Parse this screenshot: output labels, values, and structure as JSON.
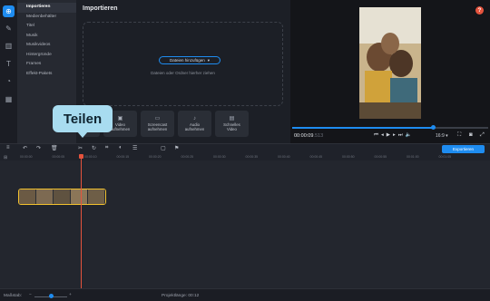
{
  "sidebar_menu": [
    {
      "label": "Importieren",
      "selected": true
    },
    {
      "label": "Medienbehälter",
      "selected": false
    },
    {
      "label": "Titel",
      "selected": false
    },
    {
      "label": "Musik",
      "selected": false
    },
    {
      "label": "Musikvideos",
      "selected": false
    },
    {
      "label": "Hintergründe",
      "selected": false
    },
    {
      "label": "Frames",
      "selected": false
    },
    {
      "label": "Effekt-Pakets",
      "selected": false
    }
  ],
  "import": {
    "title": "Importieren",
    "add_button": "Dateien hinzufügen",
    "drop_hint": "Dateien oder Ordner hierher ziehen",
    "tiles": [
      {
        "line1": "Video",
        "line2": "aufnehmen"
      },
      {
        "line1": "Screencast",
        "line2": "aufnehmen"
      },
      {
        "line1": "Audio",
        "line2": "aufnehmen"
      },
      {
        "line1": "Schnelles",
        "line2": "Video"
      }
    ]
  },
  "preview": {
    "timecode": "00:00:09",
    "timecode_sub": ".513",
    "aspect_ratio": "16:9",
    "progress": 0.72,
    "help": "?"
  },
  "toolbar": {
    "export_label": "Exportieren"
  },
  "ruler_ticks": [
    "00:00:00",
    "00:00:05",
    "00:00:10",
    "00:00:15",
    "00:00:20",
    "00:00:25",
    "00:00:30",
    "00:00:35",
    "00:00:40",
    "00:00:45",
    "00:00:50",
    "00:00:55",
    "00:01:00",
    "00:01:05"
  ],
  "tooltip": {
    "label": "Teilen"
  },
  "status": {
    "zoom_label": "Maßstab:",
    "project_length": "Projektlänge: 00:12"
  },
  "colors": {
    "accent": "#1e8cf0",
    "playhead": "#e5533d",
    "clip_border": "#f2c12e",
    "tooltip_bg": "#a8dcf0"
  }
}
